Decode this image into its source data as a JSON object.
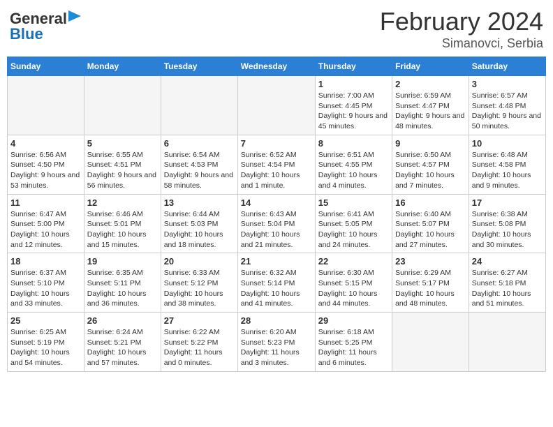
{
  "header": {
    "logo_line1": "General",
    "logo_line2": "Blue",
    "month": "February 2024",
    "location": "Simanovci, Serbia"
  },
  "weekdays": [
    "Sunday",
    "Monday",
    "Tuesday",
    "Wednesday",
    "Thursday",
    "Friday",
    "Saturday"
  ],
  "weeks": [
    [
      {
        "day": "",
        "empty": true
      },
      {
        "day": "",
        "empty": true
      },
      {
        "day": "",
        "empty": true
      },
      {
        "day": "",
        "empty": true
      },
      {
        "day": "1",
        "sunrise": "7:00 AM",
        "sunset": "4:45 PM",
        "daylight": "9 hours and 45 minutes."
      },
      {
        "day": "2",
        "sunrise": "6:59 AM",
        "sunset": "4:47 PM",
        "daylight": "9 hours and 48 minutes."
      },
      {
        "day": "3",
        "sunrise": "6:57 AM",
        "sunset": "4:48 PM",
        "daylight": "9 hours and 50 minutes."
      }
    ],
    [
      {
        "day": "4",
        "sunrise": "6:56 AM",
        "sunset": "4:50 PM",
        "daylight": "9 hours and 53 minutes."
      },
      {
        "day": "5",
        "sunrise": "6:55 AM",
        "sunset": "4:51 PM",
        "daylight": "9 hours and 56 minutes."
      },
      {
        "day": "6",
        "sunrise": "6:54 AM",
        "sunset": "4:53 PM",
        "daylight": "9 hours and 58 minutes."
      },
      {
        "day": "7",
        "sunrise": "6:52 AM",
        "sunset": "4:54 PM",
        "daylight": "10 hours and 1 minute."
      },
      {
        "day": "8",
        "sunrise": "6:51 AM",
        "sunset": "4:55 PM",
        "daylight": "10 hours and 4 minutes."
      },
      {
        "day": "9",
        "sunrise": "6:50 AM",
        "sunset": "4:57 PM",
        "daylight": "10 hours and 7 minutes."
      },
      {
        "day": "10",
        "sunrise": "6:48 AM",
        "sunset": "4:58 PM",
        "daylight": "10 hours and 9 minutes."
      }
    ],
    [
      {
        "day": "11",
        "sunrise": "6:47 AM",
        "sunset": "5:00 PM",
        "daylight": "10 hours and 12 minutes."
      },
      {
        "day": "12",
        "sunrise": "6:46 AM",
        "sunset": "5:01 PM",
        "daylight": "10 hours and 15 minutes."
      },
      {
        "day": "13",
        "sunrise": "6:44 AM",
        "sunset": "5:03 PM",
        "daylight": "10 hours and 18 minutes."
      },
      {
        "day": "14",
        "sunrise": "6:43 AM",
        "sunset": "5:04 PM",
        "daylight": "10 hours and 21 minutes."
      },
      {
        "day": "15",
        "sunrise": "6:41 AM",
        "sunset": "5:05 PM",
        "daylight": "10 hours and 24 minutes."
      },
      {
        "day": "16",
        "sunrise": "6:40 AM",
        "sunset": "5:07 PM",
        "daylight": "10 hours and 27 minutes."
      },
      {
        "day": "17",
        "sunrise": "6:38 AM",
        "sunset": "5:08 PM",
        "daylight": "10 hours and 30 minutes."
      }
    ],
    [
      {
        "day": "18",
        "sunrise": "6:37 AM",
        "sunset": "5:10 PM",
        "daylight": "10 hours and 33 minutes."
      },
      {
        "day": "19",
        "sunrise": "6:35 AM",
        "sunset": "5:11 PM",
        "daylight": "10 hours and 36 minutes."
      },
      {
        "day": "20",
        "sunrise": "6:33 AM",
        "sunset": "5:12 PM",
        "daylight": "10 hours and 38 minutes."
      },
      {
        "day": "21",
        "sunrise": "6:32 AM",
        "sunset": "5:14 PM",
        "daylight": "10 hours and 41 minutes."
      },
      {
        "day": "22",
        "sunrise": "6:30 AM",
        "sunset": "5:15 PM",
        "daylight": "10 hours and 44 minutes."
      },
      {
        "day": "23",
        "sunrise": "6:29 AM",
        "sunset": "5:17 PM",
        "daylight": "10 hours and 48 minutes."
      },
      {
        "day": "24",
        "sunrise": "6:27 AM",
        "sunset": "5:18 PM",
        "daylight": "10 hours and 51 minutes."
      }
    ],
    [
      {
        "day": "25",
        "sunrise": "6:25 AM",
        "sunset": "5:19 PM",
        "daylight": "10 hours and 54 minutes."
      },
      {
        "day": "26",
        "sunrise": "6:24 AM",
        "sunset": "5:21 PM",
        "daylight": "10 hours and 57 minutes."
      },
      {
        "day": "27",
        "sunrise": "6:22 AM",
        "sunset": "5:22 PM",
        "daylight": "11 hours and 0 minutes."
      },
      {
        "day": "28",
        "sunrise": "6:20 AM",
        "sunset": "5:23 PM",
        "daylight": "11 hours and 3 minutes."
      },
      {
        "day": "29",
        "sunrise": "6:18 AM",
        "sunset": "5:25 PM",
        "daylight": "11 hours and 6 minutes."
      },
      {
        "day": "",
        "empty": true
      },
      {
        "day": "",
        "empty": true
      }
    ]
  ]
}
